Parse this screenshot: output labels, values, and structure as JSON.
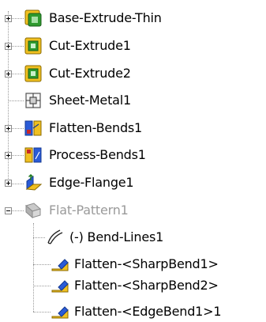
{
  "tree": {
    "items": [
      {
        "label": "Base-Extrude-Thin",
        "icon": "base-extrude-thin-icon",
        "expander": "collapsed"
      },
      {
        "label": "Cut-Extrude1",
        "icon": "cut-extrude-icon",
        "expander": "collapsed"
      },
      {
        "label": "Cut-Extrude2",
        "icon": "cut-extrude-icon",
        "expander": "collapsed"
      },
      {
        "label": "Sheet-Metal1",
        "icon": "sheet-metal-icon",
        "expander": "none"
      },
      {
        "label": "Flatten-Bends1",
        "icon": "flatten-bends-icon",
        "expander": "collapsed"
      },
      {
        "label": "Process-Bends1",
        "icon": "process-bends-icon",
        "expander": "collapsed"
      },
      {
        "label": "Edge-Flange1",
        "icon": "edge-flange-icon",
        "expander": "collapsed"
      },
      {
        "label": "Flat-Pattern1",
        "icon": "flat-pattern-icon",
        "expander": "expanded",
        "state": "suppressed",
        "children": [
          {
            "label": "(-) Bend-Lines1",
            "icon": "bend-lines-icon"
          },
          {
            "label": "Flatten-<SharpBend1>",
            "icon": "flatten-bend-icon"
          },
          {
            "label": "Flatten-<SharpBend2>",
            "icon": "flatten-bend-icon"
          },
          {
            "label": "Flatten-<EdgeBend1>1",
            "icon": "flatten-bend-icon"
          }
        ]
      }
    ]
  },
  "colors": {
    "text": "#000000",
    "suppressed_text": "#9a9a9a",
    "tree_lines": "#9a9a9a",
    "feature_green": "#2e9a2e",
    "feature_yellow": "#f0c020",
    "feature_blue": "#2a5bd7"
  }
}
